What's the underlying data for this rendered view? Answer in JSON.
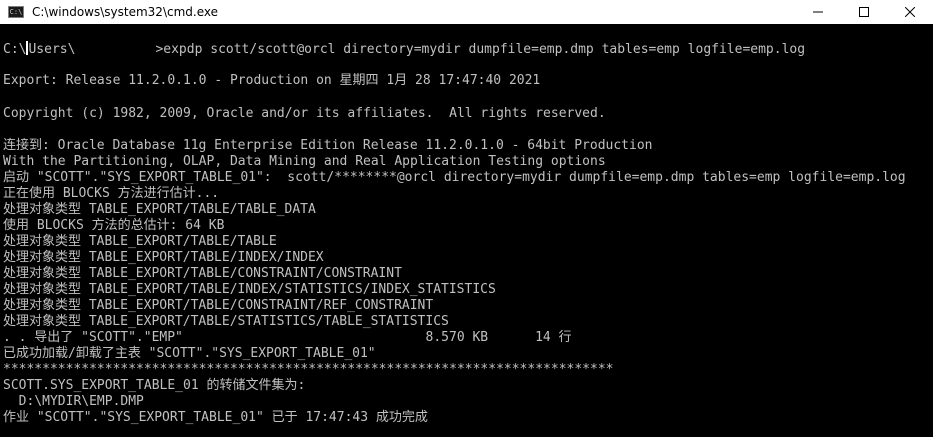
{
  "window": {
    "title": "C:\\windows\\system32\\cmd.exe",
    "icon_text": "C:\\",
    "icon": "cmd-icon",
    "controls": [
      "minimize-icon",
      "maximize-icon",
      "close-icon"
    ]
  },
  "console": {
    "prompt_prefix": "C:\\",
    "prompt_user_part": "Users\\",
    "prompt_command": ">expdp scott/scott@orcl directory=mydir dumpfile=emp.dmp tables=emp logfile=emp.log",
    "lines": [
      "Export: Release 11.2.0.1.0 - Production on 星期四 1月 28 17:47:40 2021",
      "Copyright (c) 1982, 2009, Oracle and/or its affiliates.  All rights reserved.",
      "连接到: Oracle Database 11g Enterprise Edition Release 11.2.0.1.0 - 64bit Production",
      "With the Partitioning, OLAP, Data Mining and Real Application Testing options",
      "启动 \"SCOTT\".\"SYS_EXPORT_TABLE_01\":  scott/********@orcl directory=mydir dumpfile=emp.dmp tables=emp logfile=emp.log",
      "正在使用 BLOCKS 方法进行估计...",
      "处理对象类型 TABLE_EXPORT/TABLE/TABLE_DATA",
      "使用 BLOCKS 方法的总估计: 64 KB",
      "处理对象类型 TABLE_EXPORT/TABLE/TABLE",
      "处理对象类型 TABLE_EXPORT/TABLE/INDEX/INDEX",
      "处理对象类型 TABLE_EXPORT/TABLE/CONSTRAINT/CONSTRAINT",
      "处理对象类型 TABLE_EXPORT/TABLE/INDEX/STATISTICS/INDEX_STATISTICS",
      "处理对象类型 TABLE_EXPORT/TABLE/CONSTRAINT/REF_CONSTRAINT",
      "处理对象类型 TABLE_EXPORT/TABLE/STATISTICS/TABLE_STATISTICS",
      ". . 导出了 \"SCOTT\".\"EMP\"                               8.570 KB      14 行",
      "已成功加载/卸载了主表 \"SCOTT\".\"SYS_EXPORT_TABLE_01\"",
      "******************************************************************************",
      "SCOTT.SYS_EXPORT_TABLE_01 的转储文件集为:",
      "  D:\\MYDIR\\EMP.DMP",
      "作业 \"SCOTT\".\"SYS_EXPORT_TABLE_01\" 已于 17:47:43 成功完成"
    ]
  },
  "colors": {
    "background": "#000000",
    "text": "#c0c0c0",
    "titlebar": "#ffffff"
  }
}
